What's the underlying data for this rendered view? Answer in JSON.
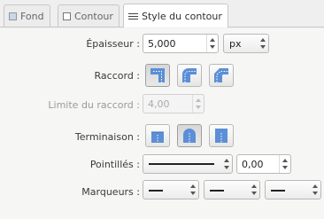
{
  "tabs": [
    {
      "label": "Fond",
      "icon": "fill-icon"
    },
    {
      "label": "Contour",
      "icon": "stroke-paint-icon"
    },
    {
      "label": "Style du contour",
      "icon": "stroke-style-icon",
      "active": true
    }
  ],
  "stroke_width": {
    "label": "Épaisseur :",
    "value": "5,000",
    "unit": "px"
  },
  "join": {
    "label": "Raccord :",
    "selected": "miter",
    "options": [
      "miter-join",
      "round-join",
      "bevel-join"
    ]
  },
  "miter_limit": {
    "label": "Limite du raccord :",
    "value": "4,00",
    "disabled": true
  },
  "cap": {
    "label": "Terminaison :",
    "selected": "round",
    "options": [
      "butt-cap",
      "round-cap",
      "square-cap"
    ]
  },
  "dashes": {
    "label": "Pointillés :",
    "pattern": "solid",
    "offset": "0,00"
  },
  "markers": {
    "label": "Marqueurs :",
    "start": "none",
    "mid": "none",
    "end": "none"
  },
  "colors": {
    "icon_blue": "#5b8fd6",
    "icon_blue_light": "#a9c3e8"
  }
}
